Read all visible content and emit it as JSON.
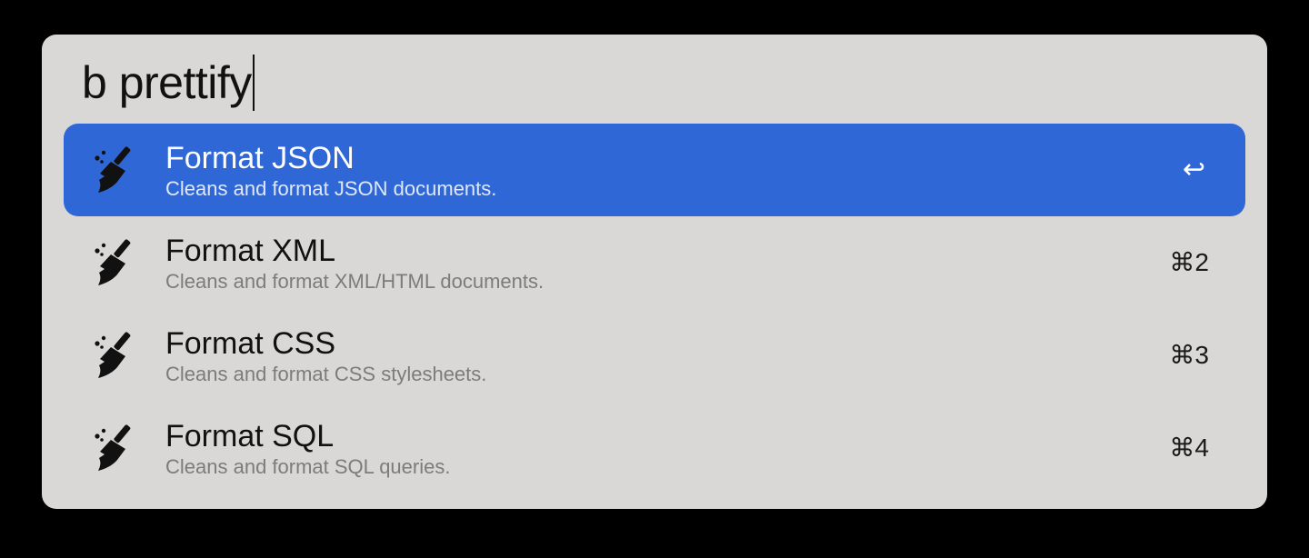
{
  "search": {
    "query": "b prettify"
  },
  "results": [
    {
      "title": "Format JSON",
      "subtitle": "Cleans and format JSON documents.",
      "shortcut": "↩",
      "icon": "broom-icon",
      "selected": true
    },
    {
      "title": "Format XML",
      "subtitle": "Cleans and format XML/HTML documents.",
      "shortcut": "⌘2",
      "icon": "broom-icon",
      "selected": false
    },
    {
      "title": "Format CSS",
      "subtitle": "Cleans and format CSS stylesheets.",
      "shortcut": "⌘3",
      "icon": "broom-icon",
      "selected": false
    },
    {
      "title": "Format SQL",
      "subtitle": "Cleans and format SQL queries.",
      "shortcut": "⌘4",
      "icon": "broom-icon",
      "selected": false
    }
  ],
  "colors": {
    "panel_background": "#d9d8d6",
    "selection": "#2f68d6",
    "window_background": "#000000"
  }
}
